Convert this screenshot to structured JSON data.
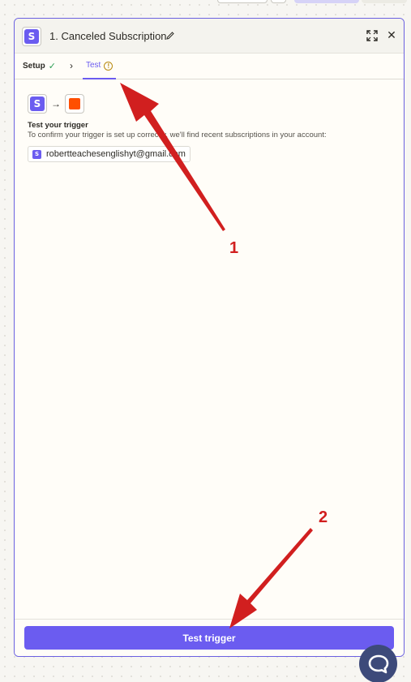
{
  "panel": {
    "step_title": "1. Canceled Subscription",
    "app_logo_letter": "S",
    "icons": {
      "edit": "pencil-icon",
      "expand": "expand-icon",
      "close": "close-icon"
    },
    "close_glyph": "✕"
  },
  "tabs": {
    "setup_label": "Setup",
    "setup_status_glyph": "✓",
    "chevron_glyph": "›",
    "test_label": "Test",
    "test_status_glyph": "!"
  },
  "flow": {
    "arrow_glyph": "→"
  },
  "test_section": {
    "title": "Test your trigger",
    "description": "To confirm your trigger is set up correctly, we'll find recent subscriptions in your account:",
    "account_email": "robertteachesenglishyt@gmail.com"
  },
  "footer": {
    "test_button_label": "Test trigger"
  },
  "annotations": {
    "num_1": "1",
    "num_2": "2"
  },
  "colors": {
    "accent": "#6b5cf0",
    "annotation_red": "#d11f1f",
    "warning": "#b88a10",
    "success": "#2e9e55",
    "trigger_orange": "#ff4f00"
  }
}
